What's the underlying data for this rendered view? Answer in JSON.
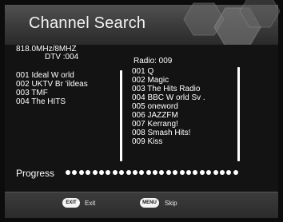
{
  "header": {
    "title": "Channel Search"
  },
  "scan": {
    "frequency": "818.0MHz/8MHZ",
    "dtv_count": "DTV :004",
    "radio_count": "Radio: 009"
  },
  "tv_channels": [
    {
      "label": "001 Ideal W orld"
    },
    {
      "label": "002 UKTV Br 'ildeas"
    },
    {
      "label": "003 TMF"
    },
    {
      "label": "004 The HITS"
    }
  ],
  "radio_channels": [
    {
      "label": "001 Q"
    },
    {
      "label": "002 Magic"
    },
    {
      "label": "003 The Hits Radio"
    },
    {
      "label": "004 BBC W orld Sv ."
    },
    {
      "label": "005 oneword"
    },
    {
      "label": "006 JAZZFM"
    },
    {
      "label": "007 Kerrang!"
    },
    {
      "label": "008 Smash Hits!"
    },
    {
      "label": "009 Kiss"
    }
  ],
  "progress": {
    "label": "Progress",
    "fraction": 1.0
  },
  "footer": {
    "exit_key": "EXIT",
    "exit_label": "Exit",
    "menu_key": "MENU",
    "skip_label": "Skip"
  },
  "icons": {
    "decoration": "hexagon-decoration-icon"
  },
  "colors": {
    "background": "#131313",
    "header": "#444444",
    "text": "#ffffff",
    "footer": "#333333"
  }
}
